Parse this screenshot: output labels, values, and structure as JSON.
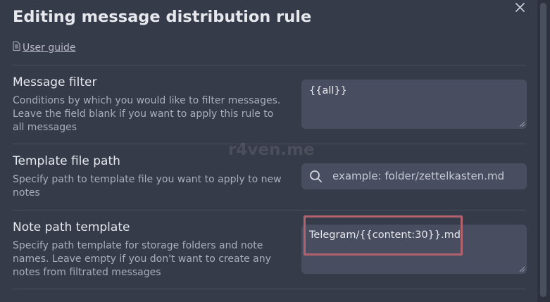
{
  "modal": {
    "title": "Editing message distribution rule",
    "close_icon": "close-icon",
    "user_guide": {
      "icon": "document-icon",
      "label": "User guide"
    }
  },
  "settings": [
    {
      "name": "Message filter",
      "description": "Conditions by which you would like to filter messages. Leave the field blank if you want to apply this rule to all messages",
      "value": "{{all}}"
    },
    {
      "name": "Template file path",
      "description": "Specify path to template file you want to apply to new notes",
      "placeholder": "example: folder/zettelkasten.md",
      "icon": "search-icon"
    },
    {
      "name": "Note path template",
      "description": "Specify path template for storage folders and note names. Leave empty if you don't want to create any notes from filtrated messages",
      "value": "Telegram/{{content:30}}.md"
    }
  ],
  "watermark": "r4ven.me",
  "colors": {
    "background": "#363b49",
    "input_background": "#484e5f",
    "highlight": "#b2626d"
  }
}
